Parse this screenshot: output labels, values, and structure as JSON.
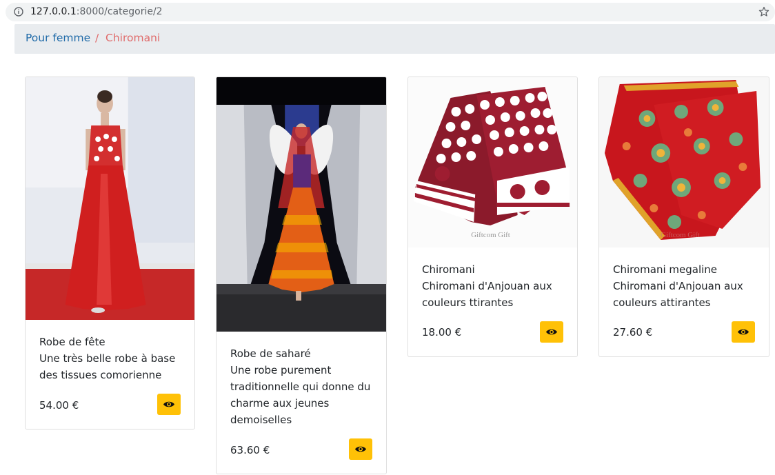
{
  "browser": {
    "url_host": "127.0.0.1",
    "url_path": ":8000/categorie/2"
  },
  "breadcrumb": {
    "home": "Pour femme",
    "separator": "/",
    "active": "Chiromani"
  },
  "products": [
    {
      "name": "Robe de fête",
      "description": "Une très belle robe à base des tissues comorienne",
      "price": "54.00 €",
      "image": "woman-red-dress-photo"
    },
    {
      "name": "Robe de saharé",
      "description": "Une robe purement traditionnelle qui donne du charme aux jeunes demoiselles",
      "price": "63.60 €",
      "image": "woman-runway-angel-photo"
    },
    {
      "name": "Chiromani",
      "description": "Chiromani d'Anjouan aux couleurs ttirantes",
      "price": "18.00 €",
      "image": "maroon-scarf-photo"
    },
    {
      "name": "Chiromani megaline",
      "description": "Chiromani d'Anjouan aux couleurs attirantes",
      "price": "27.60 €",
      "image": "red-floral-scarf-photo"
    }
  ],
  "colors": {
    "accent": "#ffc107",
    "breadcrumb_active": "#e06b6b",
    "link": "#1f6aa8"
  },
  "icons": {
    "view": "eye-icon",
    "info": "info-icon",
    "bookmark": "star-icon"
  }
}
